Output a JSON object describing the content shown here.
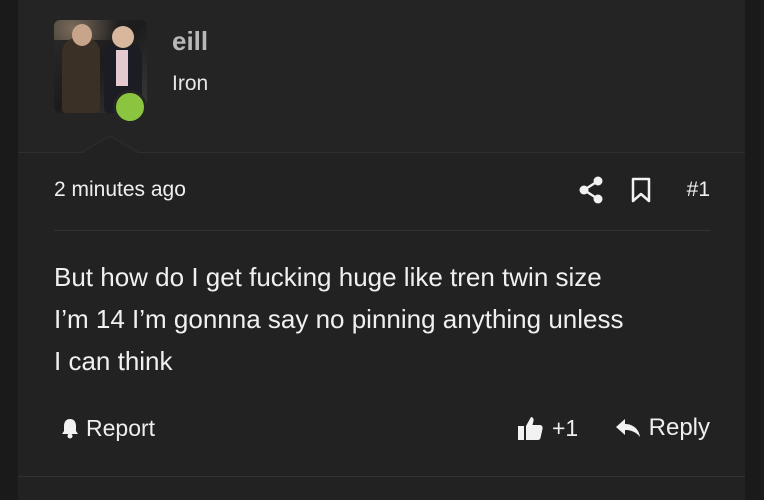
{
  "user": {
    "name": "eill",
    "title": "Iron",
    "avatar_icon": "avatar-photo",
    "online_color": "#8bc53f"
  },
  "meta": {
    "timestamp": "2 minutes ago",
    "post_number": "#1",
    "share_icon": "share-icon",
    "bookmark_icon": "bookmark-icon"
  },
  "post": {
    "body_lines": [
      "But how do I get fucking huge like tren twin size",
      "I’m 14 I’m gonnna say no pinning anything unless",
      "I can think"
    ]
  },
  "actions": {
    "report_label": "Report",
    "like_count": "+1",
    "reply_label": "Reply"
  }
}
